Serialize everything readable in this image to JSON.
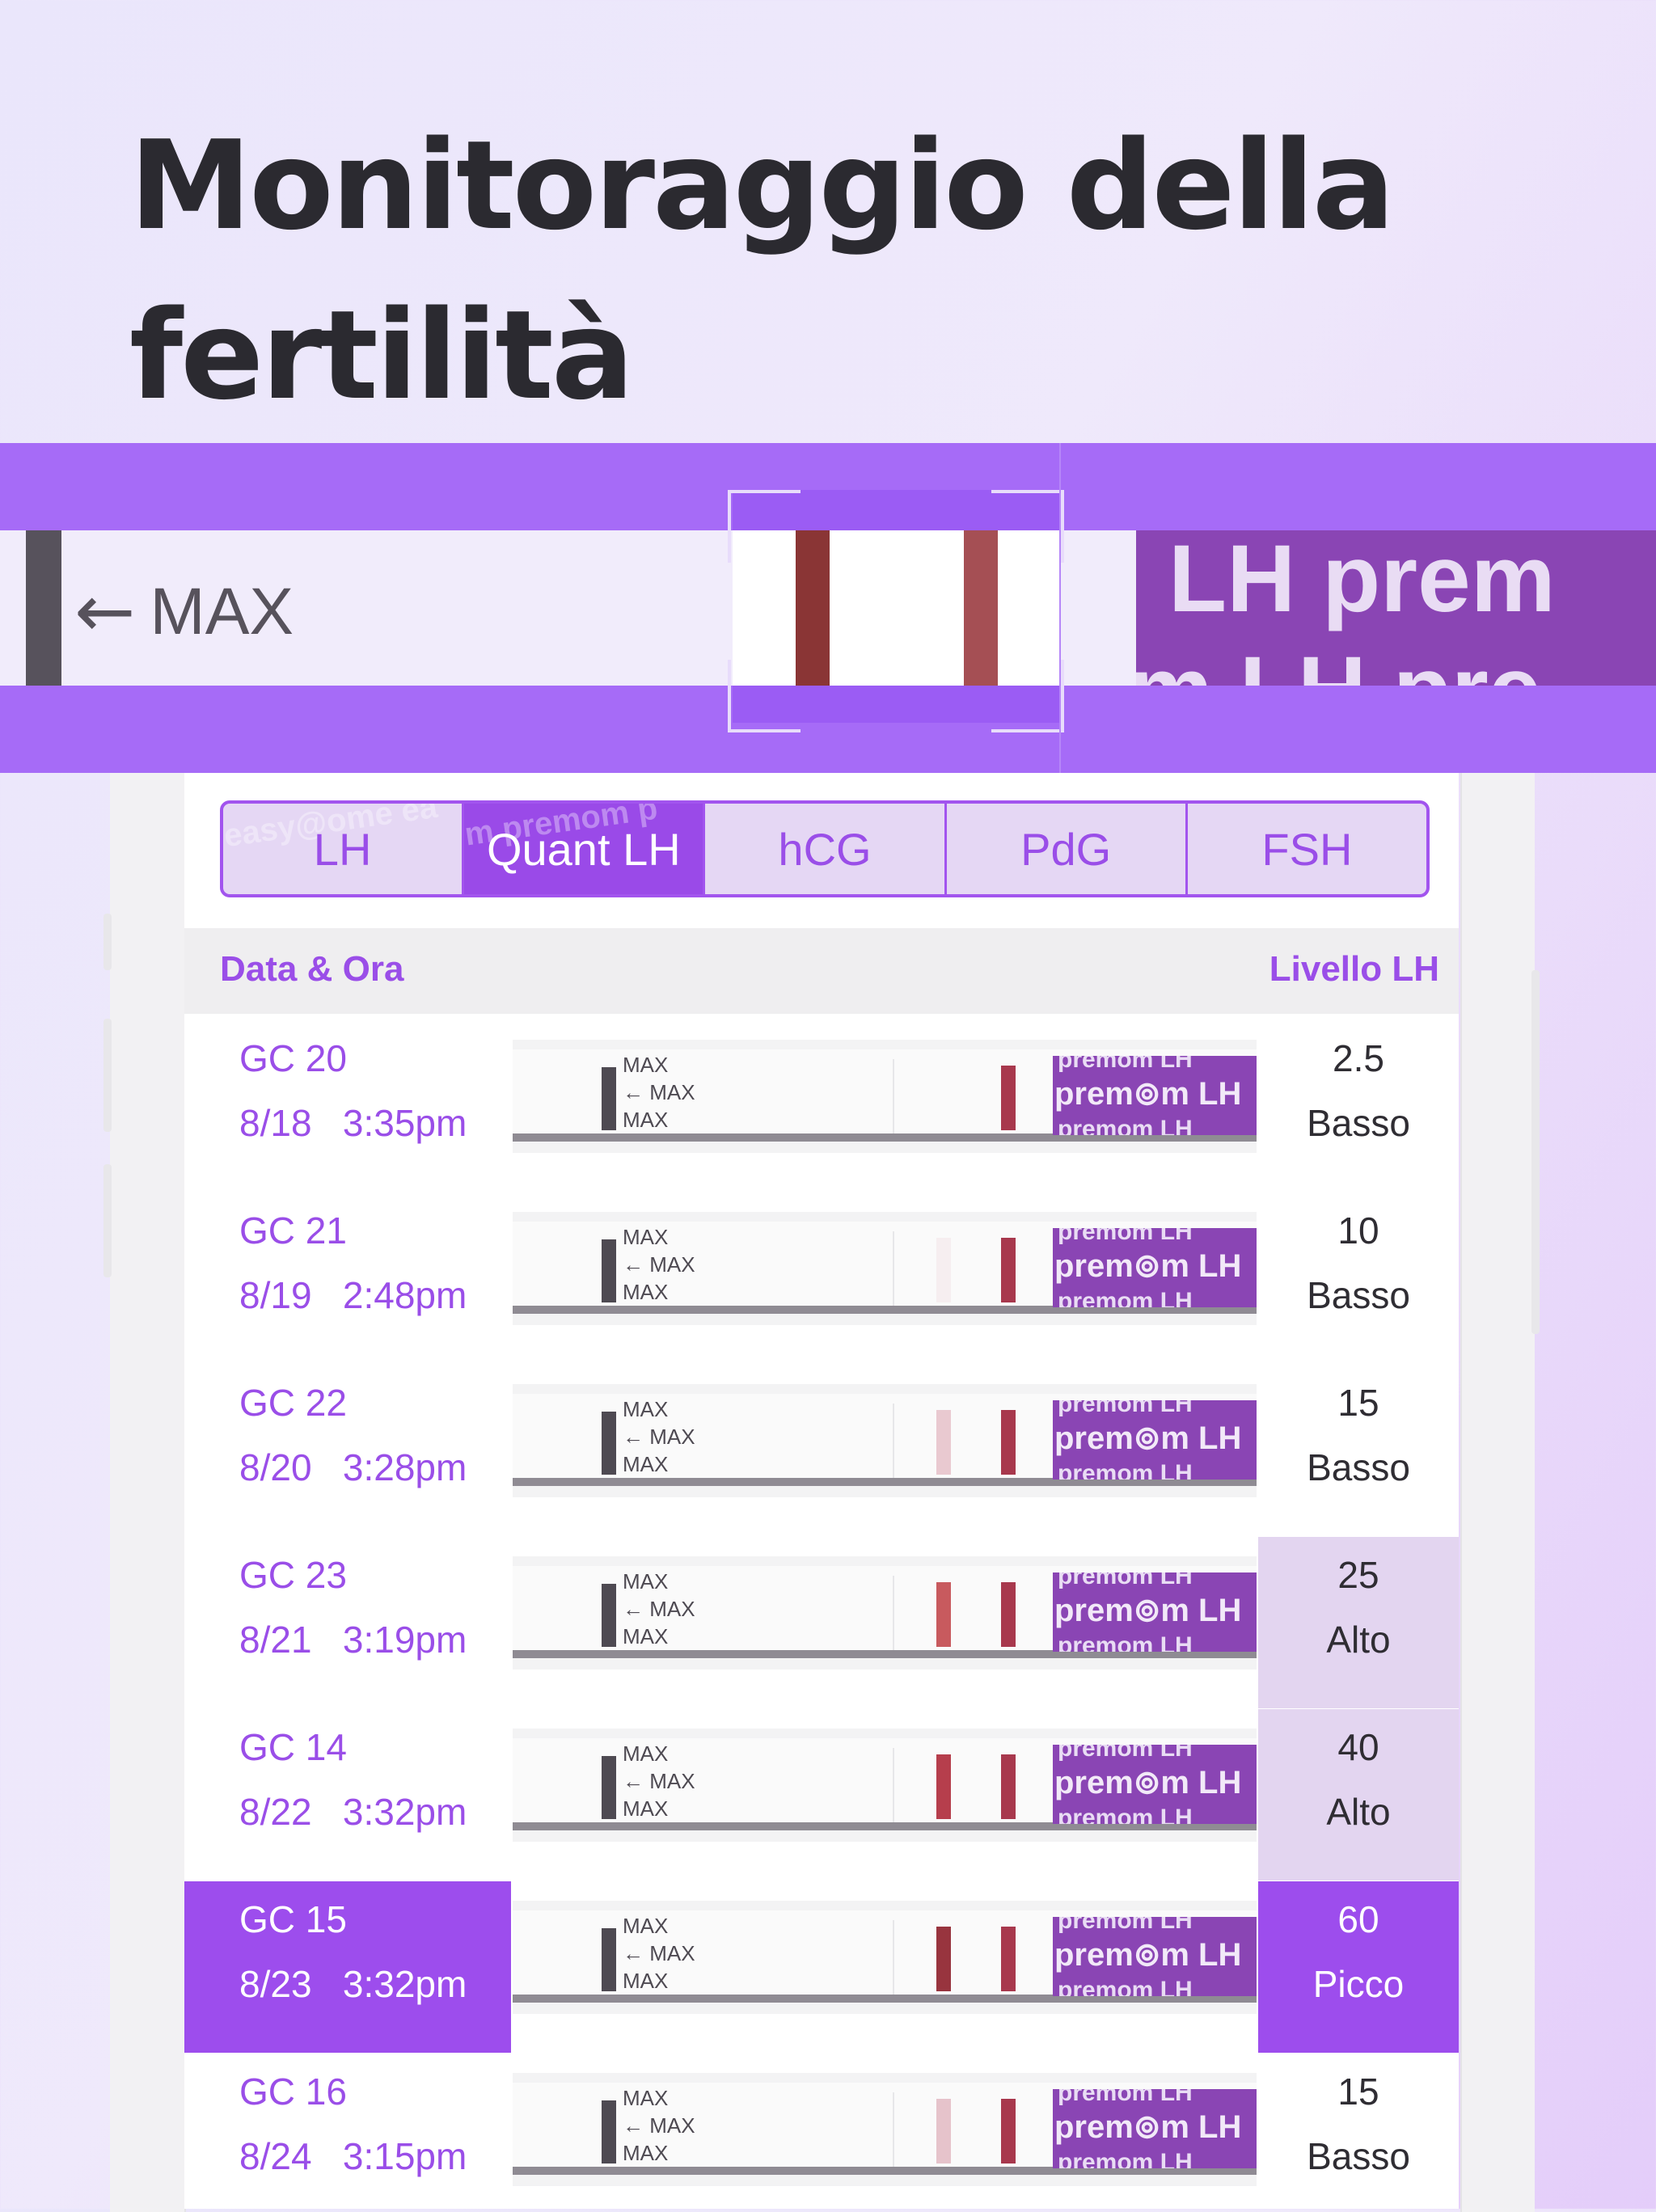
{
  "header": {
    "title": "Monitoraggio della fertilità"
  },
  "zoom": {
    "max_label": "MAX",
    "arrow": "←",
    "brand_top": "LH prem",
    "brand_bottom": "m LH pre"
  },
  "tabs": [
    {
      "label": "LH",
      "active": false,
      "watermark": "easy@ome ea"
    },
    {
      "label": "Quant LH",
      "active": true,
      "watermark": "m premom p"
    },
    {
      "label": "hCG",
      "active": false
    },
    {
      "label": "PdG",
      "active": false
    },
    {
      "label": "FSH",
      "active": false
    }
  ],
  "table": {
    "col_date": "Data & Ora",
    "col_level": "Livello LH",
    "strip_labels": {
      "max": "MAX",
      "brand_main": "prem⊚m LH",
      "brand_edge": "premom LH"
    },
    "rows": [
      {
        "cycle": "GC 20",
        "date": "8/18",
        "time": "3:35pm",
        "value": "2.5",
        "status": "Basso",
        "state": "normal",
        "test_shade": "",
        "ctrl": "#a8384d"
      },
      {
        "cycle": "GC 21",
        "date": "8/19",
        "time": "2:48pm",
        "value": "10",
        "status": "Basso",
        "state": "normal",
        "test_shade": "#f6eef0",
        "ctrl": "#a8384d"
      },
      {
        "cycle": "GC 22",
        "date": "8/20",
        "time": "3:28pm",
        "value": "15",
        "status": "Basso",
        "state": "normal",
        "test_shade": "#e9c9d0",
        "ctrl": "#a8384d"
      },
      {
        "cycle": "GC 23",
        "date": "8/21",
        "time": "3:19pm",
        "value": "25",
        "status": "Alto",
        "state": "alto",
        "test_shade": "#c85a5e",
        "ctrl": "#a8384d"
      },
      {
        "cycle": "GC 14",
        "date": "8/22",
        "time": "3:32pm",
        "value": "40",
        "status": "Alto",
        "state": "alto",
        "test_shade": "#b63e4c",
        "ctrl": "#a8384d"
      },
      {
        "cycle": "GC 15",
        "date": "8/23",
        "time": "3:32pm",
        "value": "60",
        "status": "Picco",
        "state": "picco",
        "test_shade": "#98343e",
        "ctrl": "#a8384d"
      },
      {
        "cycle": "GC 16",
        "date": "8/24",
        "time": "3:15pm",
        "value": "15",
        "status": "Basso",
        "state": "normal",
        "test_shade": "#e6c3cb",
        "ctrl": "#a8384d"
      }
    ]
  },
  "colors": {
    "accent": "#9d4ded",
    "alto_bg": "#e3d5f0",
    "title": "#2b2a30"
  }
}
